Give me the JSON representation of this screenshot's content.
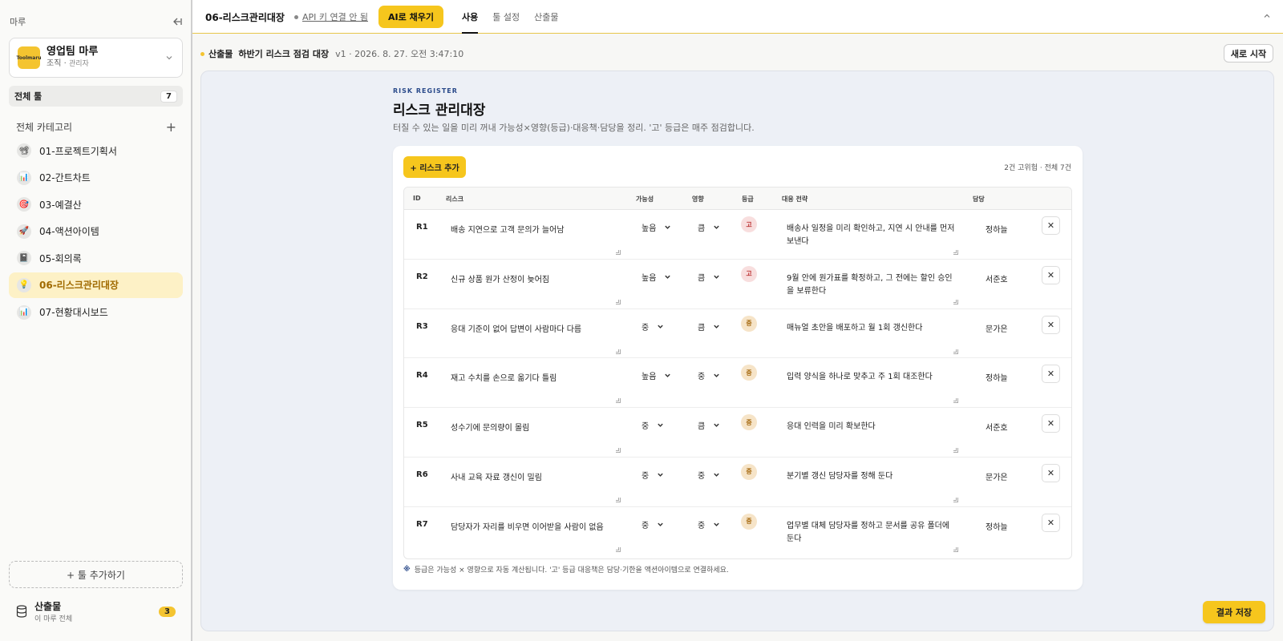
{
  "colors": {
    "accent": "#f6c61d",
    "grade_high_bg": "#f8dede",
    "grade_high_fg": "#b33",
    "grade_mid_bg": "#f6e4c8",
    "grade_mid_fg": "#a66a10"
  },
  "sidebar": {
    "brand": "마루",
    "org": {
      "logo_text": "Toolmaru",
      "name": "영업팀 마루",
      "type": "조직",
      "role": "관리자"
    },
    "all_tools": {
      "label": "전체 툴",
      "count": "7"
    },
    "category_header": "전체 카테고리",
    "items": [
      {
        "label": "01-프로젝트기획서",
        "icon": "📽"
      },
      {
        "label": "02-간트차트",
        "icon": "📊"
      },
      {
        "label": "03-예결산",
        "icon": "🎯"
      },
      {
        "label": "04-액션아이템",
        "icon": "🚀"
      },
      {
        "label": "05-회의록",
        "icon": "📓"
      },
      {
        "label": "06-리스크관리대장",
        "icon": "💡"
      },
      {
        "label": "07-현황대시보드",
        "icon": "📊"
      }
    ],
    "add_tool": "+ 툴 추가하기",
    "outputs": {
      "title": "산출물",
      "sub": "이 마루 전체",
      "count": "3"
    }
  },
  "topbar": {
    "title": "06-리스크관리대장",
    "api_status": "API 키 연결 안 됨",
    "ai_button": "AI로 채우기",
    "tabs": [
      "사용",
      "툴 설정",
      "산출물"
    ]
  },
  "subheader": {
    "kind": "산출물",
    "name": "하반기 리스크 점검 대장",
    "meta": "v1 · 2026. 8. 27. 오전 3:47:10",
    "restart": "새로 시작"
  },
  "register": {
    "eyebrow": "RISK REGISTER",
    "title": "리스크 관리대장",
    "description": "터질 수 있는 일을 미리 꺼내 가능성×영향(등급)·대응책·담당을 정리. '고' 등급은 매주 점검합니다.",
    "add_button": "+ 리스크 추가",
    "summary": "2건 고위험 · 전체 7건",
    "headers": {
      "id": "ID",
      "risk": "리스크",
      "likelihood": "가능성",
      "impact": "영향",
      "grade": "등급",
      "strategy": "대응 전략",
      "owner": "담당"
    },
    "rows": [
      {
        "id": "R1",
        "risk": "배송 지연으로 고객 문의가 늘어남",
        "likelihood": "높음",
        "impact": "큼",
        "grade": "고",
        "strategy": "배송사 일정을 미리 확인하고, 지연 시 안내를 먼저 보낸다",
        "owner": "정하늘"
      },
      {
        "id": "R2",
        "risk": "신규 상품 원가 산정이 늦어짐",
        "likelihood": "높음",
        "impact": "큼",
        "grade": "고",
        "strategy": "9월 안에 원가표를 확정하고, 그 전에는 할인 승인을 보류한다",
        "owner": "서준호"
      },
      {
        "id": "R3",
        "risk": "응대 기준이 없어 답변이 사람마다 다름",
        "likelihood": "중",
        "impact": "큼",
        "grade": "중",
        "strategy": "매뉴얼 초안을 배포하고 월 1회 갱신한다",
        "owner": "문가은"
      },
      {
        "id": "R4",
        "risk": "재고 수치를 손으로 옮기다 틀림",
        "likelihood": "높음",
        "impact": "중",
        "grade": "중",
        "strategy": "입력 양식을 하나로 맞추고 주 1회 대조한다",
        "owner": "정하늘"
      },
      {
        "id": "R5",
        "risk": "성수기에 문의량이 몰림",
        "likelihood": "중",
        "impact": "큼",
        "grade": "중",
        "strategy": "응대 인력을 미리 확보한다",
        "owner": "서준호"
      },
      {
        "id": "R6",
        "risk": "사내 교육 자료 갱신이 밀림",
        "likelihood": "중",
        "impact": "중",
        "grade": "중",
        "strategy": "분기별 갱신 담당자를 정해 둔다",
        "owner": "문가은"
      },
      {
        "id": "R7",
        "risk": "담당자가 자리를 비우면 이어받을 사람이 없음",
        "likelihood": "중",
        "impact": "중",
        "grade": "중",
        "strategy": "업무별 대체 담당자를 정하고 문서를 공유 폴더에 둔다",
        "owner": "정하늘"
      }
    ],
    "note_mark": "※",
    "note": "등급은 가능성 × 영향으로 자동 계산됩니다. '고' 등급 대응책은 담당·기한을 액션아이템으로 연결하세요.",
    "delete_symbol": "✕"
  },
  "save_button": "결과 저장"
}
